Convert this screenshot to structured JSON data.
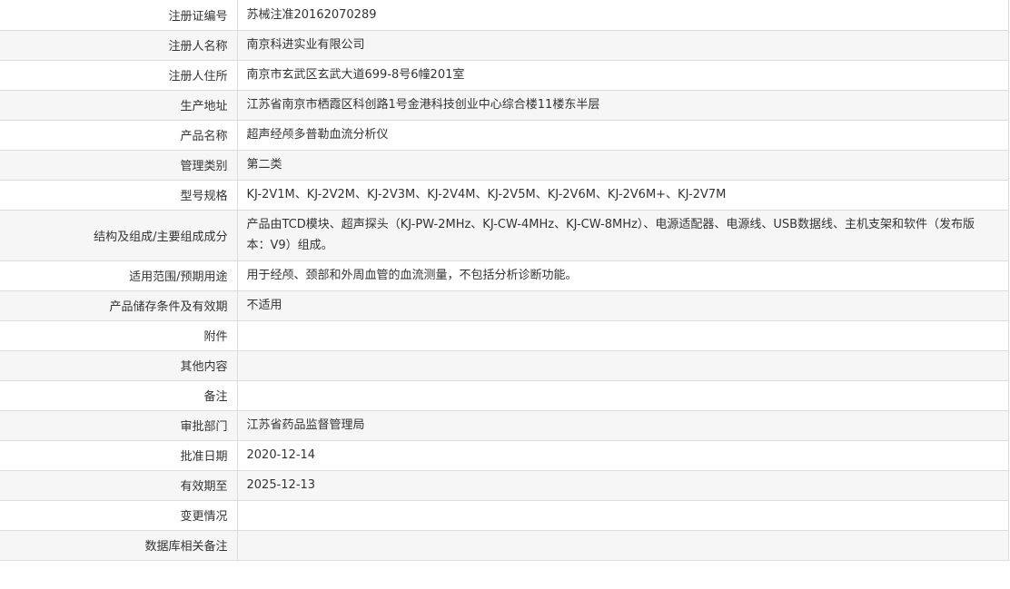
{
  "rows": [
    {
      "label": "注册证编号",
      "value": "苏械注准20162070289"
    },
    {
      "label": "注册人名称",
      "value": "南京科进实业有限公司"
    },
    {
      "label": "注册人住所",
      "value": "南京市玄武区玄武大道699-8号6幢201室"
    },
    {
      "label": "生产地址",
      "value": "江苏省南京市栖霞区科创路1号金港科技创业中心综合楼11楼东半层"
    },
    {
      "label": "产品名称",
      "value": "超声经颅多普勒血流分析仪"
    },
    {
      "label": "管理类别",
      "value": "第二类"
    },
    {
      "label": "型号规格",
      "value": "KJ-2V1M、KJ-2V2M、KJ-2V3M、KJ-2V4M、KJ-2V5M、KJ-2V6M、KJ-2V6M+、KJ-2V7M"
    },
    {
      "label": "结构及组成/主要组成成分",
      "value": "产品由TCD模块、超声探头（KJ-PW-2MHz、KJ-CW-4MHz、KJ-CW-8MHz）、电源适配器、电源线、USB数据线、主机支架和软件（发布版本：V9）组成。"
    },
    {
      "label": "适用范围/预期用途",
      "value": "用于经颅、颈部和外周血管的血流测量，不包括分析诊断功能。"
    },
    {
      "label": "产品储存条件及有效期",
      "value": "不适用"
    },
    {
      "label": "附件",
      "value": ""
    },
    {
      "label": "其他内容",
      "value": ""
    },
    {
      "label": "备注",
      "value": ""
    },
    {
      "label": "审批部门",
      "value": "江苏省药品监督管理局"
    },
    {
      "label": "批准日期",
      "value": "2020-12-14"
    },
    {
      "label": "有效期至",
      "value": "2025-12-13"
    },
    {
      "label": "变更情况",
      "value": ""
    },
    {
      "label": "数据库相关备注",
      "value": ""
    }
  ]
}
